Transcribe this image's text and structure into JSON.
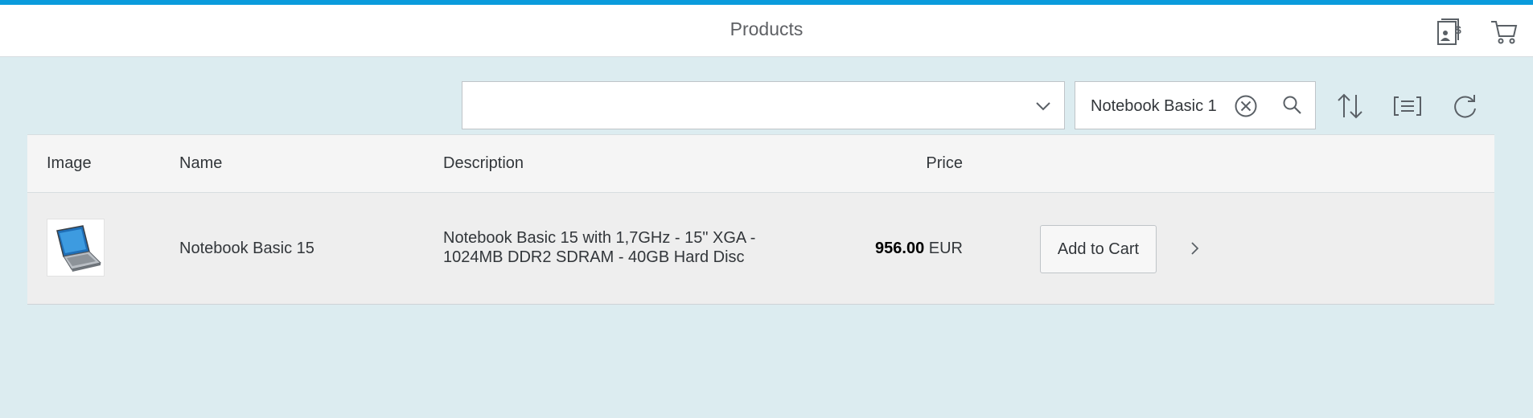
{
  "header": {
    "title": "Products",
    "icons": [
      "billing-document-icon",
      "shopping-cart-icon"
    ]
  },
  "toolbar": {
    "category_select": {
      "value": ""
    },
    "search": {
      "value": "Notebook Basic 1"
    },
    "icons": [
      "sort-icon",
      "group-icon",
      "refresh-icon"
    ]
  },
  "table": {
    "columns": {
      "image": "Image",
      "name": "Name",
      "description": "Description",
      "price": "Price"
    },
    "rows": [
      {
        "name": "Notebook Basic 15",
        "description": "Notebook Basic 15 with 1,7GHz - 15\" XGA - 1024MB DDR2 SDRAM - 40GB Hard Disc",
        "price": "956.00",
        "currency": "EUR",
        "action_label": "Add to Cart"
      }
    ]
  },
  "colors": {
    "accent": "#0a9bdc",
    "background": "#dcecf0",
    "header": "#ffffff"
  }
}
